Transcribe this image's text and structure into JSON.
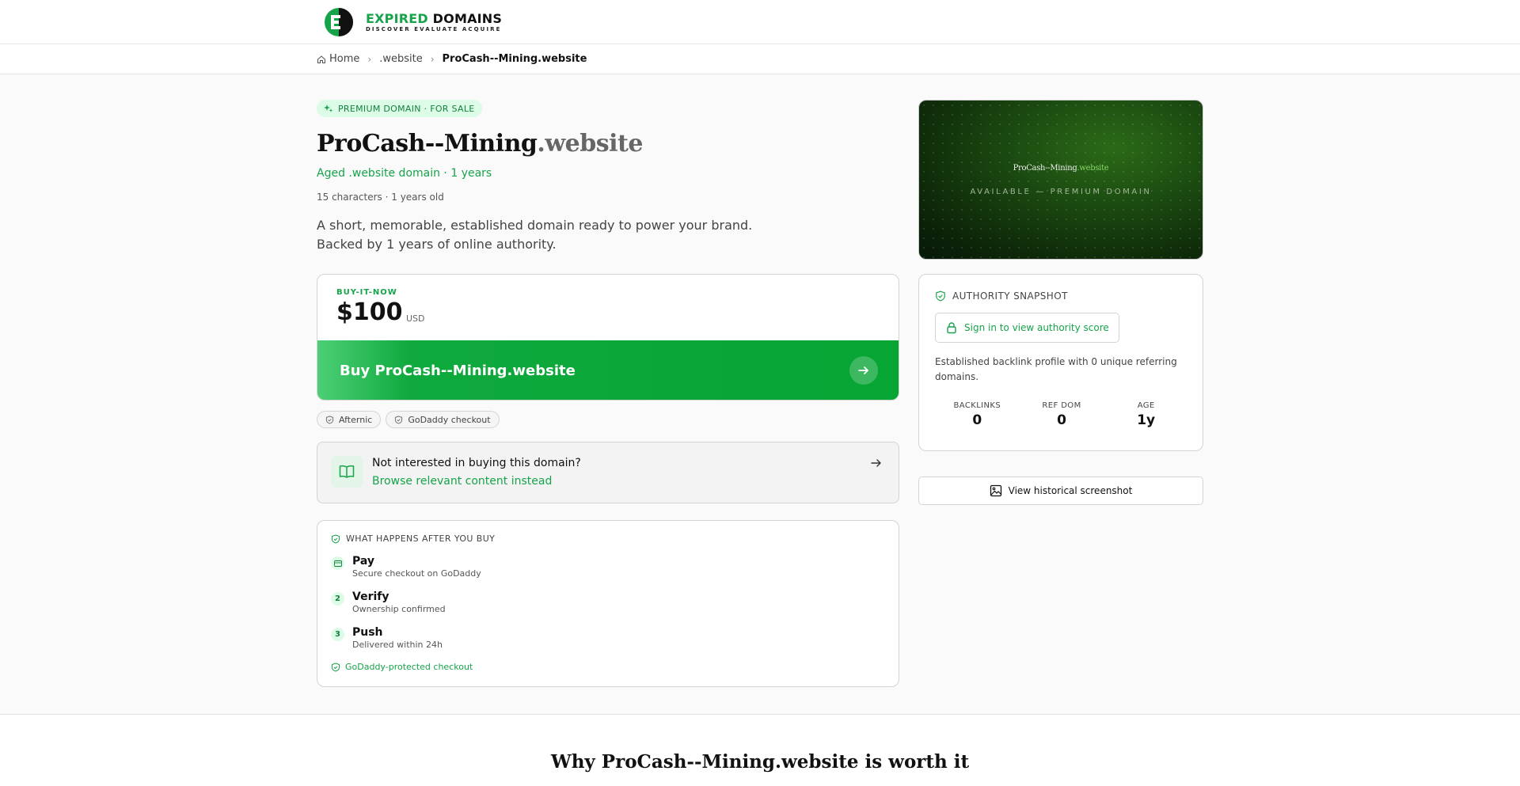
{
  "brand": {
    "name_green": "EXPIRED",
    "name_dark": "DOMAINS",
    "tagline": "DISCOVER EVALUATE ACQUIRE",
    "accent": "#16a34a"
  },
  "breadcrumb": {
    "home": "Home",
    "tld": ".website",
    "current": "ProCash--Mining.website"
  },
  "hero": {
    "badge": "PREMIUM DOMAIN · FOR SALE",
    "name": "ProCash--Mining",
    "tld": ".website",
    "subtitle": "Aged .website domain · 1 years",
    "meta": "15 characters · 1 years old",
    "desc_line1": "A short, memorable, established domain ready to power your brand.",
    "desc_line2": "Backed by 1 years of online authority."
  },
  "buy": {
    "label": "BUY-IT-NOW",
    "price": "$100",
    "currency": "USD",
    "button": "Buy ProCash--Mining.website"
  },
  "chips": [
    "Afternic",
    "GoDaddy checkout"
  ],
  "alternative": {
    "question": "Not interested in buying this domain?",
    "link": "Browse relevant content instead"
  },
  "steps": {
    "heading": "WHAT HAPPENS AFTER YOU BUY",
    "items": [
      {
        "num": "",
        "title": "Pay",
        "desc": "Secure checkout on GoDaddy"
      },
      {
        "num": "2",
        "title": "Verify",
        "desc": "Ownership confirmed"
      },
      {
        "num": "3",
        "title": "Push",
        "desc": "Delivered within 24h"
      }
    ],
    "footer": "GoDaddy-protected checkout"
  },
  "preview": {
    "name": "ProCash--Mining",
    "tld": ".website",
    "caption": "AVAILABLE — PREMIUM DOMAIN"
  },
  "authority": {
    "heading": "AUTHORITY SNAPSHOT",
    "signin": "Sign in to view authority score",
    "desc": "Established backlink profile with 0 unique referring domains.",
    "stats": [
      {
        "label": "BACKLINKS",
        "value": "0"
      },
      {
        "label": "REF DOM",
        "value": "0"
      },
      {
        "label": "AGE",
        "value": "1y"
      }
    ]
  },
  "history_button": "View historical screenshot",
  "why_heading": "Why ProCash--Mining.website is worth it"
}
